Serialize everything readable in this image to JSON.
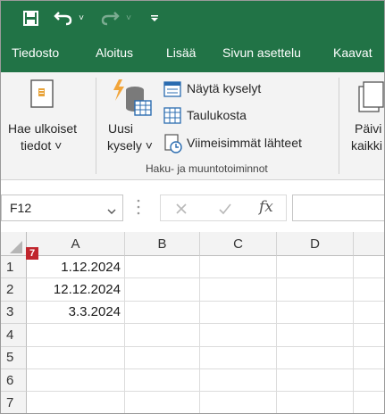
{
  "quick_access": {
    "icons": [
      "save-icon",
      "undo-icon",
      "redo-icon",
      "customize-icon"
    ]
  },
  "tabs": [
    "Tiedosto",
    "Aloitus",
    "Lisää",
    "Sivun asettelu",
    "Kaavat"
  ],
  "ribbon": {
    "get_external": {
      "line1": "Hae ulkoiset",
      "line2": "tiedot ˅"
    },
    "new_query": {
      "line1": "Uusi",
      "line2": "kysely ˅"
    },
    "show_queries": "Näytä kyselyt",
    "from_table": "Taulukosta",
    "recent_sources": "Viimeisimmät lähteet",
    "group_label": "Haku- ja muuntotoiminnot",
    "refresh": {
      "line1": "Päivi",
      "line2": "kaikki"
    }
  },
  "formula_bar": {
    "name_box": "F12",
    "fx": "fx",
    "formula": ""
  },
  "badge": "7",
  "columns": [
    "A",
    "B",
    "C",
    "D"
  ],
  "rows": [
    {
      "num": "1",
      "A": "1.12.2024"
    },
    {
      "num": "2",
      "A": "12.12.2024"
    },
    {
      "num": "3",
      "A": "3.3.2024"
    },
    {
      "num": "4",
      "A": ""
    },
    {
      "num": "5",
      "A": ""
    },
    {
      "num": "6",
      "A": ""
    },
    {
      "num": "7",
      "A": ""
    }
  ],
  "colors": {
    "accent": "#217346"
  }
}
